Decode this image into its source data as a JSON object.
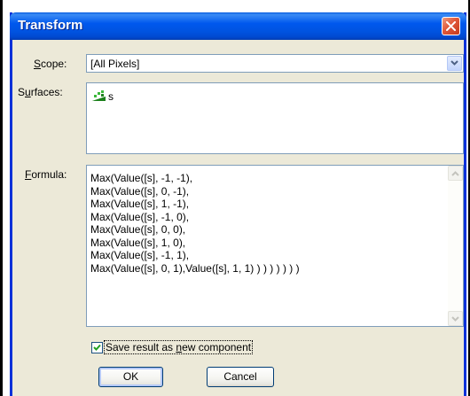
{
  "window": {
    "title": "Transform"
  },
  "scope": {
    "label_accel": "S",
    "label_rest": "cope:",
    "value": "[All Pixels]"
  },
  "surfaces": {
    "label_pre": "S",
    "label_accel": "u",
    "label_rest": "rfaces:",
    "items": [
      {
        "name": "s",
        "icon": "surface-icon"
      }
    ]
  },
  "formula": {
    "label_accel": "F",
    "label_rest": "ormula:",
    "text": "Max(Value([s], -1, -1),\nMax(Value([s], 0, -1),\nMax(Value([s], 1, -1),\nMax(Value([s], -1, 0),\nMax(Value([s], 0, 0),\nMax(Value([s], 1, 0),\nMax(Value([s], -1, 1),\nMax(Value([s], 0, 1),Value([s], 1, 1) ) ) ) ) ) ) )"
  },
  "save_result": {
    "checked": true,
    "label_pre": "Save result as ",
    "label_accel": "n",
    "label_rest": "ew component"
  },
  "buttons": {
    "ok": "OK",
    "cancel": "Cancel"
  },
  "colors": {
    "titlebar": "#0058ee",
    "dialog_bg": "#ece9d8",
    "close_button": "#e0583a",
    "checkmark": "#21a121"
  }
}
